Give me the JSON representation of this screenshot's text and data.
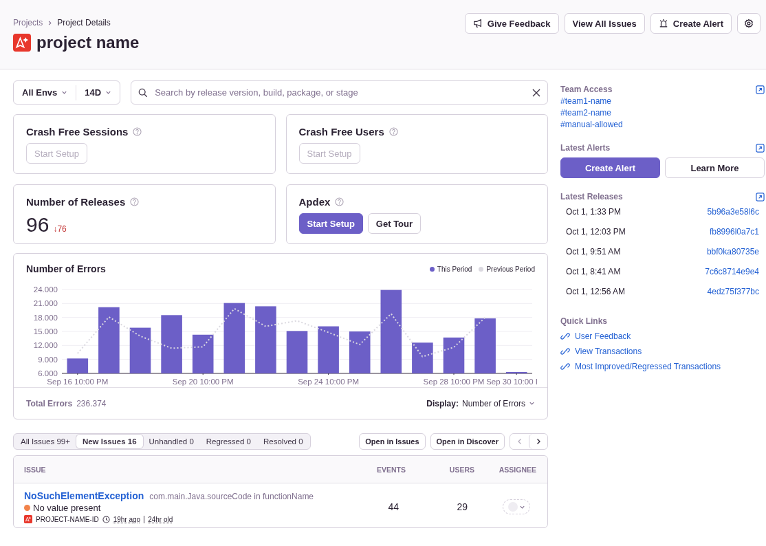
{
  "header": {
    "breadcrumbs": [
      {
        "label": "Projects",
        "current": false
      },
      {
        "label": "Project Details",
        "current": true
      }
    ],
    "title": "project name",
    "actions": [
      "Give Feedback",
      "View All Issues",
      "Create Alert"
    ]
  },
  "filters": {
    "env": "All Envs",
    "period": "14D",
    "search": {
      "placeholder": "Search by release version, build, package, or stage"
    }
  },
  "cards": [
    {
      "title": "Crash Free Sessions",
      "kind": "setup",
      "buttons": [
        {
          "label": "Start Setup",
          "primary": false,
          "disabled": true
        }
      ]
    },
    {
      "title": "Crash Free Users",
      "kind": "setup",
      "buttons": [
        {
          "label": "Start Setup",
          "primary": false,
          "disabled": true
        }
      ]
    },
    {
      "title": "Number of Releases",
      "kind": "count",
      "value": "96",
      "change": "↓76"
    },
    {
      "title": "Apdex",
      "kind": "setup",
      "buttons": [
        {
          "label": "Start Setup",
          "primary": true,
          "disabled": false
        },
        {
          "label": "Get Tour",
          "primary": false,
          "disabled": false
        }
      ]
    }
  ],
  "errors": {
    "title": "Number of Errors",
    "chart_data": {
      "type": "bar",
      "categories": [
        "Sep 16 10:00 PM",
        null,
        null,
        null,
        "Sep 20 10:00 PM",
        null,
        null,
        null,
        "Sep 24 10:00 PM",
        null,
        null,
        null,
        "Sep 28 10:00 PM",
        null,
        "Sep 30 10:00 I"
      ],
      "series": [
        {
          "name": "This Period",
          "color": "#6c5fc7",
          "values": [
            9200,
            20200,
            15800,
            18500,
            14300,
            21100,
            20400,
            15100,
            16100,
            15000,
            23900,
            12600,
            13700,
            17800,
            6200
          ]
        },
        {
          "name": "Previous Period",
          "color": "#dbd9e0",
          "type": "line",
          "line_style": "dashed",
          "values": [
            10300,
            18100,
            14000,
            11400,
            11700,
            19900,
            16100,
            17300,
            14800,
            12200,
            18800,
            9600,
            11600,
            18000,
            null
          ]
        }
      ],
      "grid": true,
      "ylim": [
        6000,
        24000
      ],
      "yticks": [
        {
          "value": 6000,
          "label": "6.000"
        },
        {
          "value": 9000,
          "label": "9.000"
        },
        {
          "value": 12000,
          "label": "12.000"
        },
        {
          "value": 15000,
          "label": "15.000"
        },
        {
          "value": 18000,
          "label": "18.000"
        },
        {
          "value": 21000,
          "label": "21.000"
        },
        {
          "value": 24000,
          "label": "24.000"
        }
      ]
    },
    "total_label": "Total Errors",
    "total_value": "236.374",
    "display_label": "Display:",
    "display_value": "Number of Errors"
  },
  "issues": {
    "tabs": [
      {
        "label": "All Issues 99+",
        "selected": false
      },
      {
        "label": "New Issues 16",
        "selected": true
      },
      {
        "label": "Unhandled 0",
        "selected": false
      },
      {
        "label": "Regressed 0",
        "selected": false
      },
      {
        "label": "Resolved 0",
        "selected": false
      }
    ],
    "actions": [
      "Open in Issues",
      "Open in Discover"
    ],
    "columns": [
      "ISSUE",
      "EVENTS",
      "USERS",
      "ASSIGNEE"
    ],
    "rows": [
      {
        "title": "NoSuchElementException",
        "culprit": "com.main.Java.sourceCode in functionName",
        "message": "No value present",
        "color": "#f2834a",
        "project": "PROJECT-NAME-ID",
        "last_seen": "19hr ago",
        "age": "24hr old",
        "events": "44",
        "users": "29"
      }
    ]
  },
  "sidebar": {
    "team_access": {
      "title": "Team Access",
      "teams": [
        "#team1-name",
        "#team2-name",
        "#manual-allowed"
      ]
    },
    "alerts": {
      "title": "Latest Alerts",
      "buttons": [
        {
          "label": "Create Alert",
          "primary": true
        },
        {
          "label": "Learn More",
          "primary": false
        }
      ]
    },
    "releases": {
      "title": "Latest Releases",
      "items": [
        {
          "date": "Oct 1, 1:33 PM",
          "version": "5b96a3e58l6c"
        },
        {
          "date": "Oct 1, 12:03 PM",
          "version": "fb8996l0a7c1"
        },
        {
          "date": "Oct 1, 9:51 AM",
          "version": "bbf0ka80735e"
        },
        {
          "date": "Oct 1, 8:41 AM",
          "version": "7c6c8714e9e4"
        },
        {
          "date": "Oct 1, 12:56 AM",
          "version": "4edz75f377bc"
        }
      ]
    },
    "quick_links": {
      "title": "Quick Links",
      "links": [
        "User Feedback",
        "View Transactions",
        "Most Improved/Regressed Transactions"
      ]
    }
  }
}
